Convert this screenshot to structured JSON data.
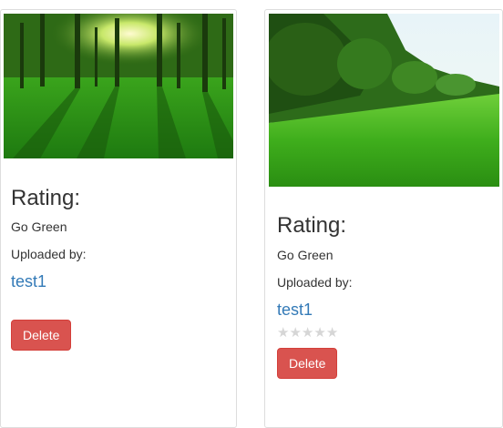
{
  "cards": [
    {
      "image_icon": "forest-sunlight-photo",
      "rating_heading": "Rating:",
      "description": "Go Green",
      "uploaded_by_label": "Uploaded by:",
      "user": "test1",
      "delete_label": "Delete"
    },
    {
      "image_icon": "green-field-photo",
      "rating_heading": "Rating:",
      "description": "Go Green",
      "uploaded_by_label": "Uploaded by:",
      "user": "test1",
      "stars": [
        "★",
        "★",
        "★",
        "★",
        "★"
      ],
      "star_rating": 0,
      "delete_label": "Delete"
    }
  ],
  "colors": {
    "link": "#337ab7",
    "delete_button": "#d9534f",
    "star_empty": "#d6d6d6",
    "card_border": "#dddddd"
  }
}
